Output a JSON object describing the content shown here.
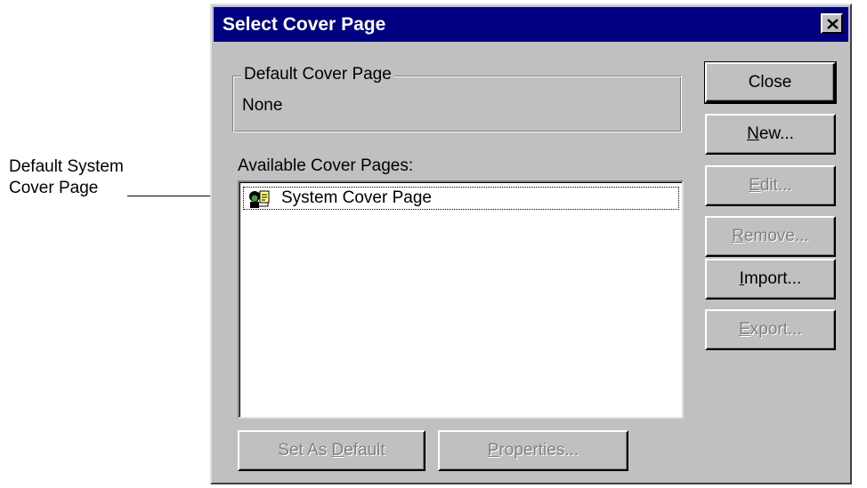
{
  "callout": {
    "line1": "Default System",
    "line2": "Cover Page"
  },
  "dialog": {
    "title": "Select Cover Page",
    "default_group": {
      "legend": "Default Cover Page",
      "value": "None"
    },
    "available_label": "Available Cover Pages:",
    "list_items": [
      {
        "label": "System Cover Page",
        "icon": "cover-page-icon"
      }
    ],
    "buttons": {
      "close": "Close",
      "new": {
        "mnemonic": "N",
        "rest": "ew..."
      },
      "edit": {
        "mnemonic": "E",
        "rest": "dit..."
      },
      "remove": {
        "mnemonic": "R",
        "rest": "emove..."
      },
      "import": {
        "mnemonic": "I",
        "rest": "mport..."
      },
      "export": {
        "mnemonic": "E",
        "rest": "xport..."
      },
      "set_default": {
        "before": "Set As ",
        "mnemonic": "D",
        "rest": "efault"
      },
      "properties": {
        "mnemonic": "P",
        "rest": "roperties..."
      }
    }
  },
  "colors": {
    "titlebar": "#000080",
    "face": "#c0c0c0",
    "disabled_text": "#808080"
  }
}
